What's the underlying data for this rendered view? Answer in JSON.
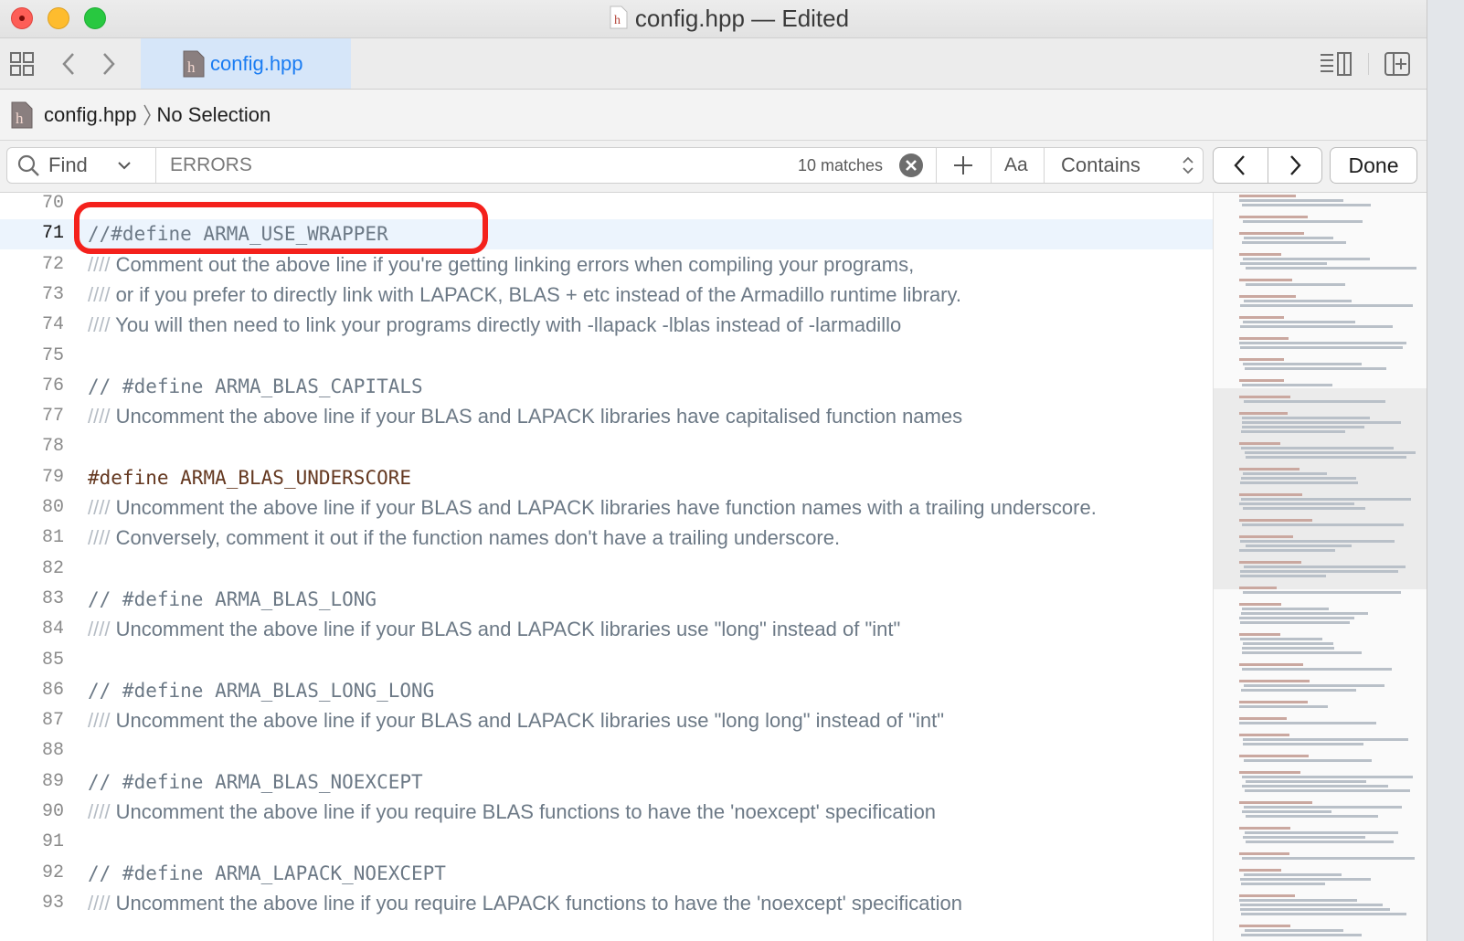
{
  "window": {
    "title": "config.hpp — Edited"
  },
  "tab": {
    "label": "config.hpp"
  },
  "jumpbar": {
    "file": "config.hpp",
    "selection": "No Selection"
  },
  "find": {
    "mode": "Find",
    "query": "ERRORS",
    "matches": "10 matches",
    "case_label": "Aa",
    "match_type": "Contains",
    "done_label": "Done"
  },
  "editor": {
    "lines": [
      {
        "num": "70",
        "kind": "blank",
        "text": ""
      },
      {
        "num": "71",
        "kind": "mono-comment",
        "text": "//#define ARMA_USE_WRAPPER",
        "current": true
      },
      {
        "num": "72",
        "kind": "doc",
        "prefix": "////",
        "text": " Comment out the above line if you're getting linking errors when compiling your programs,"
      },
      {
        "num": "73",
        "kind": "doc",
        "prefix": "////",
        "text": " or if you prefer to directly link with LAPACK, BLAS + etc instead of the Armadillo runtime library."
      },
      {
        "num": "74",
        "kind": "doc",
        "prefix": "////",
        "text": " You will then need to link your programs directly with -llapack -lblas instead of -larmadillo"
      },
      {
        "num": "75",
        "kind": "blank",
        "text": ""
      },
      {
        "num": "76",
        "kind": "mono-comment",
        "text": "// #define ARMA_BLAS_CAPITALS"
      },
      {
        "num": "77",
        "kind": "doc",
        "prefix": "////",
        "text": " Uncomment the above line if your BLAS and LAPACK libraries have capitalised function names"
      },
      {
        "num": "78",
        "kind": "blank",
        "text": ""
      },
      {
        "num": "79",
        "kind": "define",
        "keyword": "#define",
        "text": " ARMA_BLAS_UNDERSCORE"
      },
      {
        "num": "80",
        "kind": "doc",
        "prefix": "////",
        "text": " Uncomment the above line if your BLAS and LAPACK libraries have function names with a trailing underscore."
      },
      {
        "num": "81",
        "kind": "doc",
        "prefix": "////",
        "text": " Conversely, comment it out if the function names don't have a trailing underscore."
      },
      {
        "num": "82",
        "kind": "blank",
        "text": ""
      },
      {
        "num": "83",
        "kind": "mono-comment",
        "text": "// #define ARMA_BLAS_LONG"
      },
      {
        "num": "84",
        "kind": "doc",
        "prefix": "////",
        "text": " Uncomment the above line if your BLAS and LAPACK libraries use \"long\" instead of \"int\""
      },
      {
        "num": "85",
        "kind": "blank",
        "text": ""
      },
      {
        "num": "86",
        "kind": "mono-comment",
        "text": "// #define ARMA_BLAS_LONG_LONG"
      },
      {
        "num": "87",
        "kind": "doc",
        "prefix": "////",
        "text": " Uncomment the above line if your BLAS and LAPACK libraries use \"long long\" instead of \"int\""
      },
      {
        "num": "88",
        "kind": "blank",
        "text": ""
      },
      {
        "num": "89",
        "kind": "mono-comment",
        "text": "// #define ARMA_BLAS_NOEXCEPT"
      },
      {
        "num": "90",
        "kind": "doc",
        "prefix": "////",
        "text": " Uncomment the above line if you require BLAS functions to have the 'noexcept' specification"
      },
      {
        "num": "91",
        "kind": "blank",
        "text": ""
      },
      {
        "num": "92",
        "kind": "mono-comment",
        "text": "// #define ARMA_LAPACK_NOEXCEPT"
      },
      {
        "num": "93",
        "kind": "doc",
        "prefix": "////",
        "text": " Uncomment the above line if you require LAPACK functions to have the 'noexcept' specification"
      }
    ]
  },
  "colors": {
    "accent": "#1a7cf2",
    "comment": "#6c7986",
    "preprocessor": "#643820",
    "annotation_ring": "#f4211c"
  }
}
